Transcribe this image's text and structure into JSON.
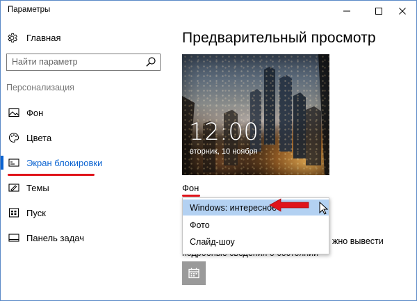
{
  "window": {
    "title": "Параметры",
    "controls": [
      "minimize",
      "maximize",
      "close"
    ]
  },
  "sidebar": {
    "home_label": "Главная",
    "search_placeholder": "Найти параметр",
    "section_header": "Персонализация",
    "items": [
      {
        "label": "Фон",
        "icon": "image-icon",
        "active": false
      },
      {
        "label": "Цвета",
        "icon": "palette-icon",
        "active": false
      },
      {
        "label": "Экран блокировки",
        "icon": "lock-screen-icon",
        "active": true
      },
      {
        "label": "Темы",
        "icon": "themes-icon",
        "active": false
      },
      {
        "label": "Пуск",
        "icon": "start-icon",
        "active": false
      },
      {
        "label": "Панель задач",
        "icon": "taskbar-icon",
        "active": false
      }
    ]
  },
  "main": {
    "title": "Предварительный просмотр",
    "preview_time": "12:00",
    "preview_date": "вторник, 10 ноября",
    "background_label": "Фон",
    "dropdown_options": [
      "Windows: интересное",
      "Фото",
      "Слайд-шоу"
    ],
    "dropdown_selected": "Windows: интересное",
    "help_line1_tail": "жно вывести",
    "help_line2": "подробные сведения о состоянии",
    "tile_icon": "calendar-icon"
  },
  "colors": {
    "accent": "#0a63d1",
    "annotation_red": "#e0141b",
    "selected_option": "#b3d1f2",
    "tile_gray": "#9a9a9a"
  }
}
